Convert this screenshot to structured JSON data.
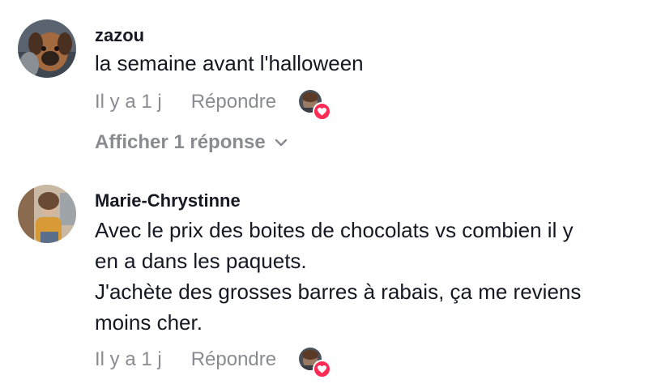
{
  "comments": [
    {
      "username": "zazou",
      "lines": [
        "la semaine avant l'halloween"
      ],
      "timestamp": "Il y a 1 j",
      "reply_label": "Répondre",
      "liked_by_creator": true,
      "show_replies_label": "Afficher 1 réponse"
    },
    {
      "username": "Marie-Chrystinne",
      "lines": [
        "Avec le prix des boites de chocolats vs combien il y",
        "en a dans les paquets.",
        "J'achète des grosses barres à rabais, ça me reviens",
        "moins cher."
      ],
      "timestamp": "Il y a 1 j",
      "reply_label": "Répondre",
      "liked_by_creator": true
    }
  ],
  "colors": {
    "text_primary": "#161823",
    "text_secondary": "#8a8b91",
    "heart_badge": "#fe2c55"
  },
  "icons": {
    "heart": "heart-icon",
    "chevron": "chevron-down-icon"
  }
}
